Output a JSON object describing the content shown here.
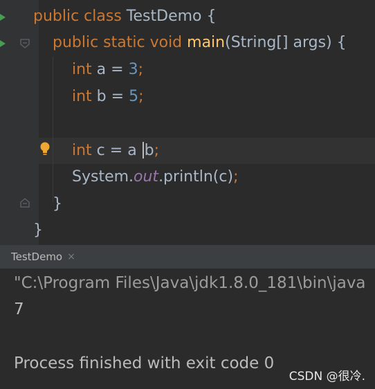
{
  "editor": {
    "lines": [
      {
        "id": "class-decl",
        "tokens": [
          {
            "t": "public class",
            "c": "kw"
          },
          {
            "t": " TestDemo ",
            "c": "plain"
          },
          {
            "t": "{",
            "c": "plain"
          }
        ]
      },
      {
        "id": "main-decl",
        "tokens": [
          {
            "t": "public static void",
            "c": "kw"
          },
          {
            "t": " ",
            "c": "plain"
          },
          {
            "t": "main",
            "c": "fn"
          },
          {
            "t": "(String[] args) {",
            "c": "plain"
          }
        ]
      },
      {
        "id": "int-a",
        "tokens": [
          {
            "t": "int",
            "c": "kw"
          },
          {
            "t": " a = ",
            "c": "plain"
          },
          {
            "t": "3",
            "c": "num"
          },
          {
            "t": ";",
            "c": "punct"
          }
        ]
      },
      {
        "id": "int-b",
        "tokens": [
          {
            "t": "int",
            "c": "kw"
          },
          {
            "t": " b = ",
            "c": "plain"
          },
          {
            "t": "5",
            "c": "num"
          },
          {
            "t": ";",
            "c": "punct"
          }
        ]
      },
      {
        "id": "blank",
        "tokens": []
      },
      {
        "id": "int-c",
        "tokens": [
          {
            "t": "int",
            "c": "kw"
          },
          {
            "t": " c = a ",
            "c": "plain"
          },
          {
            "t": "|",
            "c": "caret"
          },
          {
            "t": "b",
            "c": "plain"
          },
          {
            "t": ";",
            "c": "punct"
          }
        ]
      },
      {
        "id": "println",
        "tokens": [
          {
            "t": "System.",
            "c": "plain"
          },
          {
            "t": "out",
            "c": "field"
          },
          {
            "t": ".println(c)",
            "c": "plain"
          },
          {
            "t": ";",
            "c": "punct"
          }
        ]
      },
      {
        "id": "close-main",
        "tokens": [
          {
            "t": "}",
            "c": "plain"
          }
        ]
      },
      {
        "id": "close-class",
        "tokens": [
          {
            "t": "}",
            "c": "plain"
          }
        ]
      }
    ]
  },
  "run_panel": {
    "tab_label": "TestDemo",
    "close_glyph": "×",
    "console": [
      "\"C:\\Program Files\\Java\\jdk1.8.0_181\\bin\\java",
      "7",
      "",
      "Process finished with exit code 0"
    ]
  },
  "watermark": "CSDN @很冷.",
  "colors": {
    "keyword": "#cc7832",
    "number": "#6897bb",
    "method": "#ffc66d",
    "field": "#9876aa",
    "text": "#a9b7c6",
    "run": "#499c54"
  },
  "icons": [
    "run-icon",
    "fold-icon",
    "lightbulb-icon",
    "tab-icon",
    "close-icon"
  ]
}
